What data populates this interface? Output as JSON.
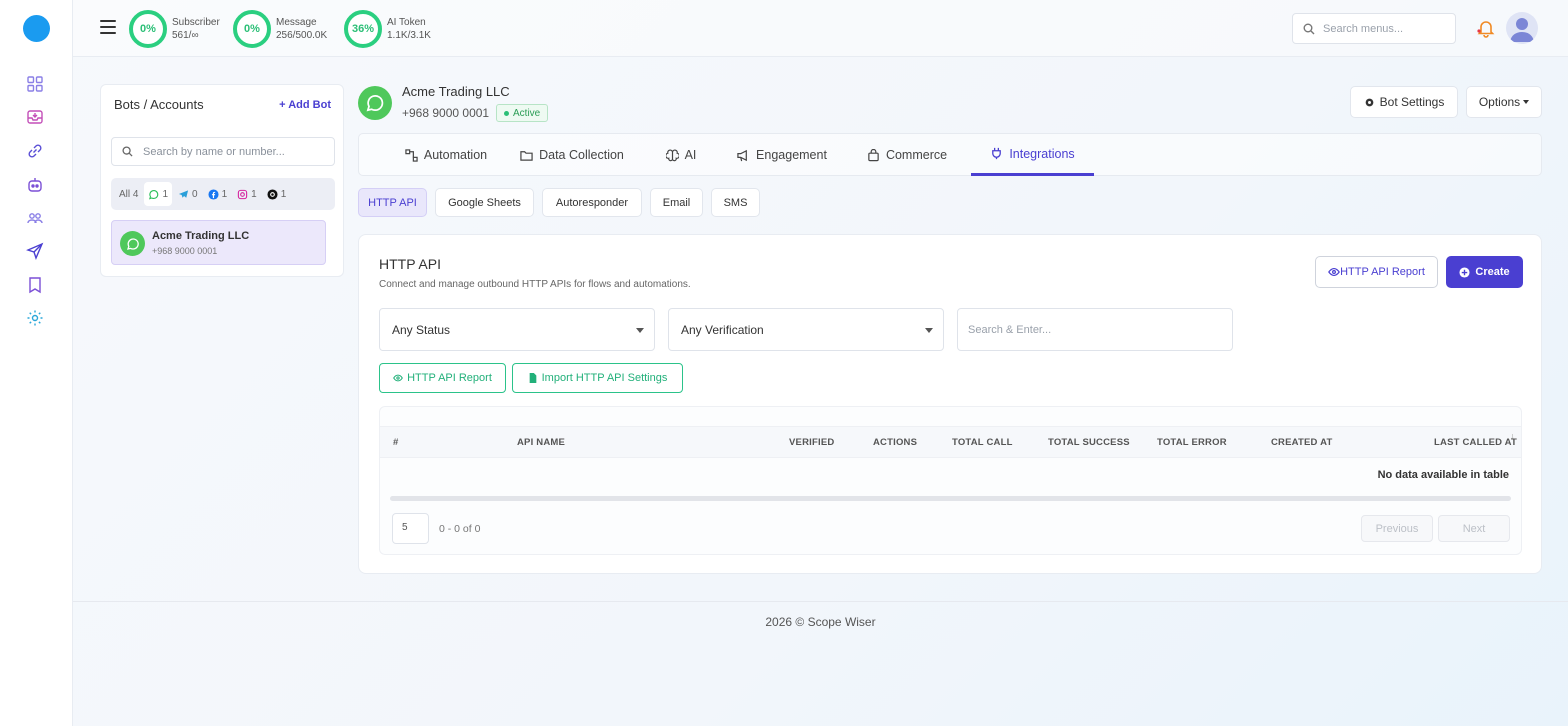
{
  "topbar": {
    "stats": [
      {
        "percent": "0%",
        "label": "Subscriber",
        "value": "561/∞"
      },
      {
        "percent": "0%",
        "label": "Message",
        "value": "256/500.0K"
      },
      {
        "percent": "36%",
        "label": "AI Token",
        "value": "1.1K/3.1K"
      }
    ],
    "search_placeholder": "Search menus..."
  },
  "sidebar": {
    "icons": [
      "dashboard-icon",
      "inbox-icon",
      "link-icon",
      "bot-icon",
      "users-icon",
      "send-icon",
      "bookmark-icon",
      "settings-icon"
    ]
  },
  "bots_panel": {
    "title": "Bots / Accounts",
    "add_label": "Add Bot",
    "search_placeholder": "Search by name or number...",
    "filters": [
      {
        "label": "All",
        "count": "4"
      },
      {
        "label": "",
        "count": "1",
        "icon": "whatsapp-icon"
      },
      {
        "label": "",
        "count": "0",
        "icon": "telegram-icon"
      },
      {
        "label": "",
        "count": "1",
        "icon": "facebook-icon"
      },
      {
        "label": "",
        "count": "1",
        "icon": "instagram-icon"
      },
      {
        "label": "",
        "count": "1",
        "icon": "threads-icon"
      }
    ],
    "items": [
      {
        "name": "Acme Trading LLC",
        "number": "+968 9000 0001"
      }
    ]
  },
  "account": {
    "name": "Acme Trading LLC",
    "number": "+968 9000 0001",
    "status": "Active",
    "bot_settings_label": "Bot Settings",
    "options_label": "Options"
  },
  "tabs": [
    {
      "label": "Automation",
      "icon": "automation-icon"
    },
    {
      "label": "Data Collection",
      "icon": "folder-icon"
    },
    {
      "label": "AI",
      "icon": "brain-icon"
    },
    {
      "label": "Engagement",
      "icon": "megaphone-icon"
    },
    {
      "label": "Commerce",
      "icon": "bag-icon"
    },
    {
      "label": "Integrations",
      "icon": "plug-icon"
    }
  ],
  "subtabs": [
    "HTTP API",
    "Google Sheets",
    "Autoresponder",
    "Email",
    "SMS"
  ],
  "main": {
    "title": "HTTP API",
    "subtitle": "Connect and manage outbound HTTP APIs for flows and automations.",
    "report_label": "HTTP API Report",
    "create_label": "Create",
    "status_select": "Any Status",
    "verification_select": "Any Verification",
    "search_placeholder": "Search & Enter...",
    "report_btn_label": "HTTP API Report",
    "import_btn_label": "Import HTTP API Settings"
  },
  "table": {
    "columns": [
      "#",
      "API NAME",
      "VERIFIED",
      "ACTIONS",
      "TOTAL CALL",
      "TOTAL SUCCESS",
      "TOTAL ERROR",
      "CREATED AT",
      "LAST CALLED AT"
    ],
    "empty_text": "No data available in table",
    "page_size": "5",
    "page_info": "0 - 0 of 0",
    "prev_label": "Previous",
    "next_label": "Next"
  },
  "footer": "2026 © Scope Wiser",
  "colors": {
    "accent": "#4a3fd1",
    "green": "#2bcf80",
    "whatsapp": "#4fc85b"
  }
}
